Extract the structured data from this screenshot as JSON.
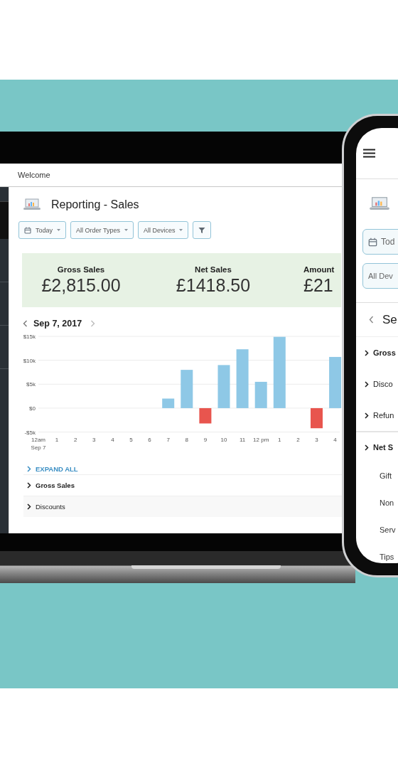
{
  "laptop": {
    "header": {
      "title": "Welcome"
    },
    "page": {
      "title": "Reporting - Sales",
      "filters": [
        {
          "kind": "date",
          "label": "Today"
        },
        {
          "kind": "dropdown",
          "label": "All Order Types"
        },
        {
          "kind": "dropdown",
          "label": "All Devices"
        },
        {
          "kind": "filter"
        }
      ],
      "metrics": [
        {
          "label": "Gross Sales",
          "value": "£2,815.00"
        },
        {
          "label": "Net Sales",
          "value": "£1418.50"
        },
        {
          "label": "Amount",
          "value": "£21"
        }
      ],
      "date_nav": {
        "date": "Sep 7, 2017"
      },
      "chart_data": {
        "type": "bar",
        "stacked": true,
        "categories": [
          "12am",
          "1",
          "2",
          "3",
          "4",
          "5",
          "6",
          "7",
          "8",
          "9",
          "10",
          "11",
          "12 pm",
          "1",
          "2",
          "3",
          "4"
        ],
        "yticks": [
          {
            "value": -5000,
            "label": "-$5k"
          },
          {
            "value": 0,
            "label": "$0"
          },
          {
            "value": 5000,
            "label": "$5k"
          },
          {
            "value": 10000,
            "label": "$10k"
          },
          {
            "value": 15000,
            "label": "$15k"
          }
        ],
        "ylim": [
          -5000,
          15000
        ],
        "grid": true,
        "series": [
          {
            "color": "#8ec8e6",
            "values": [
              null,
              null,
              null,
              null,
              null,
              null,
              null,
              2000,
              8000,
              null,
              9000,
              12300,
              5500,
              14900,
              null,
              null,
              10700
            ]
          },
          {
            "color": "#e8554e",
            "values": [
              null,
              null,
              null,
              null,
              null,
              null,
              null,
              null,
              null,
              -3200,
              null,
              null,
              null,
              null,
              null,
              -4200,
              null
            ]
          }
        ],
        "annotations": [
          "Sep 7"
        ]
      },
      "expand_all": "EXPAND ALL",
      "sections": [
        {
          "kind": "total",
          "label": "Gross Sales"
        },
        {
          "kind": "group",
          "label": "Discounts"
        }
      ]
    }
  },
  "phone": {
    "fields": [
      {
        "kind": "date",
        "label": "Tod"
      },
      {
        "kind": "dropdown",
        "label": "All Dev"
      }
    ],
    "nav_title": "Se",
    "sections": [
      {
        "kind": "total",
        "label": "Gross"
      },
      {
        "kind": "group",
        "label": "Disco"
      },
      {
        "kind": "group",
        "label": "Refun"
      },
      {
        "kind": "total",
        "label": "Net S"
      },
      {
        "kind": "detail",
        "label": "Gift"
      },
      {
        "kind": "detail",
        "label": "Non"
      },
      {
        "kind": "detail",
        "label": "Serv"
      },
      {
        "kind": "detail",
        "label": "Tips"
      }
    ]
  }
}
